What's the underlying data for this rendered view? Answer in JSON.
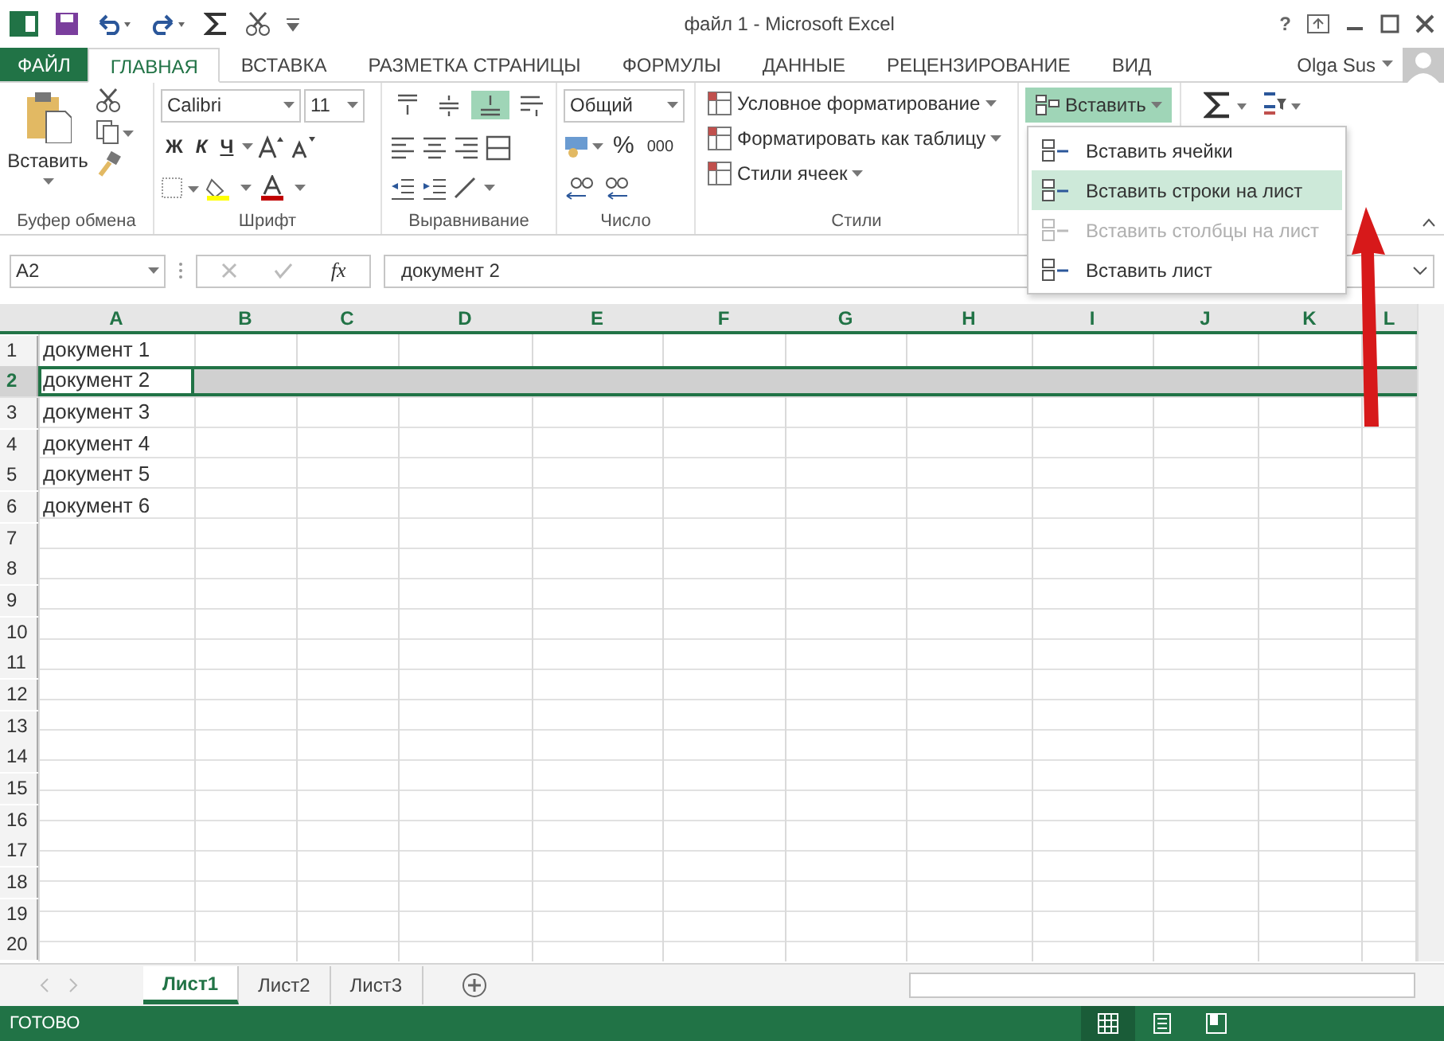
{
  "window": {
    "title": "файл 1 - Microsoft Excel",
    "help": "?"
  },
  "tabs": [
    {
      "label": "ФАЙЛ",
      "kind": "file",
      "selected": false
    },
    {
      "label": "ГЛАВНАЯ",
      "kind": "tab",
      "selected": true
    },
    {
      "label": "ВСТАВКА",
      "kind": "tab",
      "selected": false
    },
    {
      "label": "РАЗМЕТКА СТРАНИЦЫ",
      "kind": "tab",
      "selected": false
    },
    {
      "label": "ФОРМУЛЫ",
      "kind": "tab",
      "selected": false
    },
    {
      "label": "ДАННЫЕ",
      "kind": "tab",
      "selected": false
    },
    {
      "label": "РЕЦЕНЗИРОВАНИЕ",
      "kind": "tab",
      "selected": false
    },
    {
      "label": "ВИД",
      "kind": "tab",
      "selected": false
    }
  ],
  "user": {
    "name": "Olga Sus"
  },
  "ribbon": {
    "clipboard": {
      "paste": "Вставить",
      "label": "Буфер обмена"
    },
    "font": {
      "name": "Calibri",
      "size": "11",
      "bold": "Ж",
      "italic": "К",
      "underline": "Ч",
      "label": "Шрифт"
    },
    "alignment": {
      "label": "Выравнивание",
      "buttons": [
        {
          "kind": "top",
          "selected": false
        },
        {
          "kind": "middle",
          "selected": false
        },
        {
          "kind": "bottom",
          "selected": true
        },
        {
          "kind": "wrap",
          "selected": false
        }
      ]
    },
    "number": {
      "format": "Общий",
      "percent": "%",
      "thousands": "000",
      "label": "Число"
    },
    "styles": {
      "items": [
        "Условное форматирование",
        "Форматировать как таблицу",
        "Стили ячеек"
      ],
      "label": "Стили"
    },
    "cells": {
      "insert": "Вставить",
      "expanded": true
    }
  },
  "insert_menu": [
    {
      "label": "Вставить ячейки",
      "selected": false,
      "disabled": false
    },
    {
      "label": "Вставить строки на лист",
      "selected": true,
      "disabled": false
    },
    {
      "label": "Вставить столбцы на лист",
      "selected": false,
      "disabled": true
    },
    {
      "label": "Вставить лист",
      "selected": false,
      "disabled": false
    }
  ],
  "formula_bar": {
    "name_box": "A2",
    "fx": "fx",
    "value": "документ 2"
  },
  "columns": [
    {
      "label": "A",
      "selected": true
    },
    {
      "label": "B",
      "selected": true
    },
    {
      "label": "C",
      "selected": true
    },
    {
      "label": "D",
      "selected": true
    },
    {
      "label": "E",
      "selected": true
    },
    {
      "label": "F",
      "selected": true
    },
    {
      "label": "G",
      "selected": true
    },
    {
      "label": "H",
      "selected": true
    },
    {
      "label": "I",
      "selected": true
    },
    {
      "label": "J",
      "selected": true
    },
    {
      "label": "K",
      "selected": true
    },
    {
      "label": "L",
      "selected": true
    }
  ],
  "rows": [
    {
      "header": "1",
      "cell": "документ 1",
      "selected": false
    },
    {
      "header": "2",
      "cell": "документ 2",
      "selected": true
    },
    {
      "header": "3",
      "cell": "документ 3",
      "selected": false
    },
    {
      "header": "4",
      "cell": "документ 4",
      "selected": false
    },
    {
      "header": "5",
      "cell": "документ 5",
      "selected": false
    },
    {
      "header": "6",
      "cell": "документ 6",
      "selected": false
    },
    {
      "header": "7",
      "selected": false
    },
    {
      "header": "8",
      "selected": false
    },
    {
      "header": "9",
      "selected": false
    },
    {
      "header": "10",
      "selected": false
    },
    {
      "header": "11",
      "selected": false
    },
    {
      "header": "12",
      "selected": false
    },
    {
      "header": "13",
      "selected": false
    },
    {
      "header": "14",
      "selected": false
    },
    {
      "header": "15",
      "selected": false
    },
    {
      "header": "16",
      "selected": false
    },
    {
      "header": "17",
      "selected": false
    },
    {
      "header": "18",
      "selected": false
    },
    {
      "header": "19",
      "selected": false
    },
    {
      "header": "20",
      "selected": false
    }
  ],
  "sheets": [
    {
      "label": "Лист1",
      "selected": true
    },
    {
      "label": "Лист2",
      "selected": false
    },
    {
      "label": "Лист3",
      "selected": false
    }
  ],
  "status_bar": {
    "text": "ГОТОВО",
    "view_buttons": [
      {
        "kind": "normal",
        "selected": true
      },
      {
        "kind": "layout",
        "selected": false
      },
      {
        "kind": "break",
        "selected": false
      }
    ]
  }
}
